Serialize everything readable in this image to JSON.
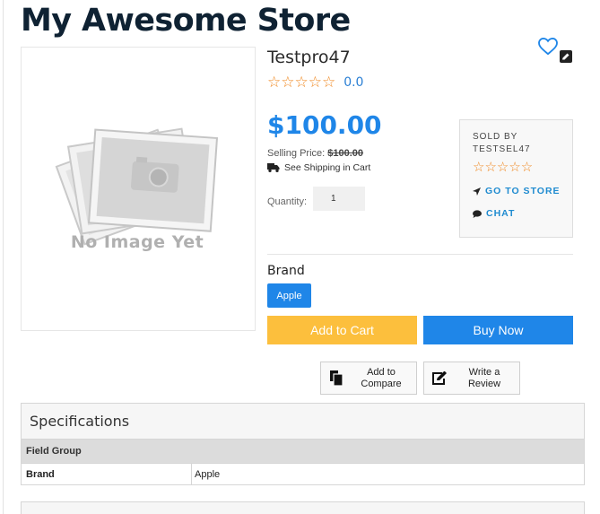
{
  "store": {
    "title": "My Awesome Store"
  },
  "product": {
    "name": "Testpro47",
    "rating_stars": "☆☆☆☆☆",
    "rating_value": "0.0",
    "image_placeholder_text": "No Image Yet",
    "price": "$100.00",
    "selling_price_label": "Selling Price:",
    "selling_price_value": "$100.00",
    "shipping_text": "See Shipping in Cart",
    "quantity_label": "Quantity:",
    "quantity_value": "1"
  },
  "seller": {
    "sold_by_label": "SOLD BY",
    "seller_name": "TESTSEL47",
    "stars": "☆☆☆☆☆",
    "go_to_store": "GO TO STORE",
    "chat": "CHAT"
  },
  "brand": {
    "label": "Brand",
    "value": "Apple"
  },
  "actions": {
    "add_to_cart": "Add to Cart",
    "buy_now": "Buy Now",
    "compare_line1": "Add to",
    "compare_line2": "Compare",
    "review_line1": "Write a",
    "review_line2": "Review"
  },
  "specifications": {
    "title": "Specifications",
    "group": "Field Group",
    "rows": [
      {
        "key": "Brand",
        "value": "Apple"
      }
    ]
  },
  "colors": {
    "accent": "#1f86e8",
    "star": "#f08a24",
    "cart": "#fcbf3d"
  },
  "icons": [
    "heart-icon",
    "edit-icon",
    "truck-icon",
    "location-arrow-icon",
    "chat-icon",
    "copy-icon",
    "pencil-square-icon",
    "camera-placeholder-icon"
  ]
}
